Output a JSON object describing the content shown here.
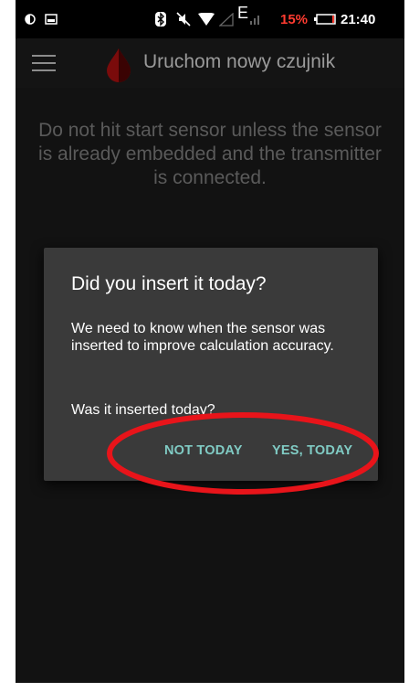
{
  "status_bar": {
    "battery_percent": "15%",
    "time": "21:40",
    "network_label": "E",
    "battery_color": "#ff3b30",
    "icons": [
      "brightness-icon",
      "image-icon",
      "bluetooth-icon",
      "mute-icon",
      "wifi-icon",
      "signal-icon",
      "battery-icon"
    ]
  },
  "app_bar": {
    "title": "Uruchom nowy czujnik",
    "icons": [
      "menu-icon",
      "blood-drop-icon"
    ]
  },
  "main": {
    "info_text": "Do not hit start sensor unless the sensor is already embedded and the transmitter is connected."
  },
  "dialog": {
    "title": "Did you insert it today?",
    "message": "We need to know when the sensor was inserted to improve calculation accuracy.",
    "question": "Was it inserted today?",
    "buttons": {
      "not_today": "NOT TODAY",
      "yes_today": "YES, TODAY"
    },
    "button_color": "#80cbc4"
  },
  "annotation": {
    "highlight_color": "#e8141a"
  }
}
